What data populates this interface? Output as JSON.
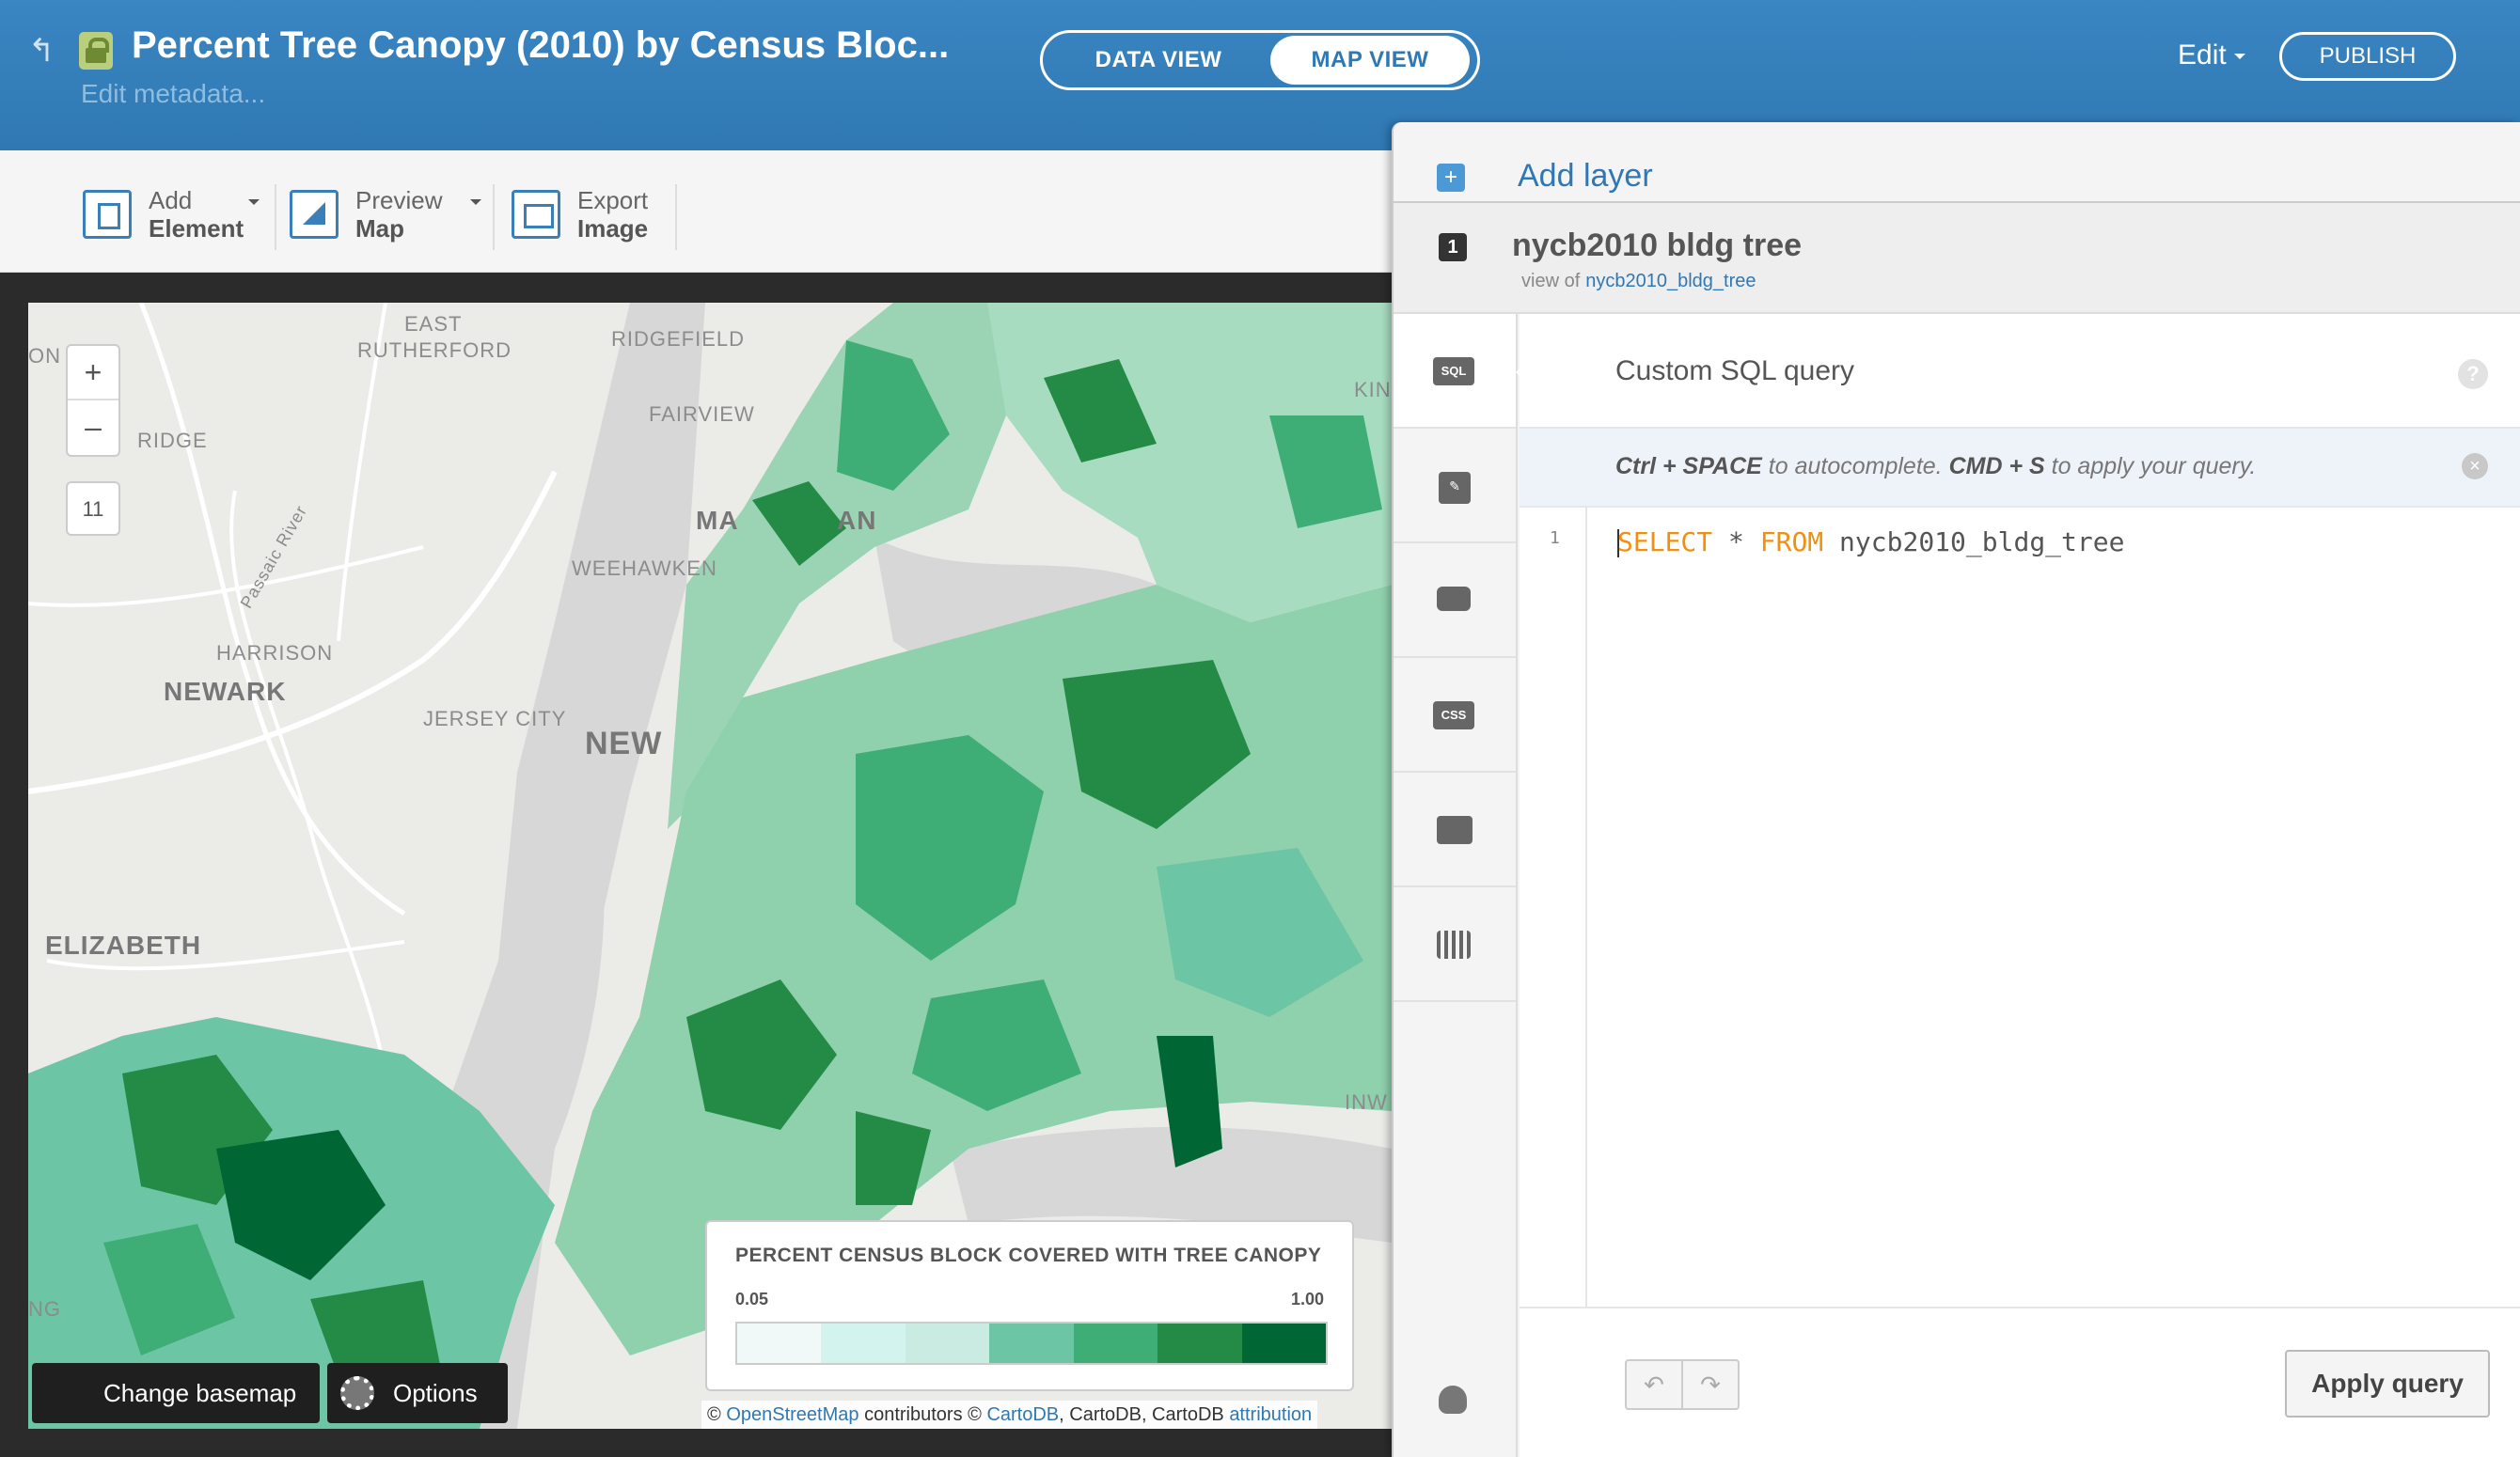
{
  "header": {
    "title": "Percent Tree Canopy (2010) by Census Bloc...",
    "subtitle": "Edit metadata...",
    "view_data": "DATA VIEW",
    "view_map": "MAP VIEW",
    "edit_label": "Edit",
    "publish_label": "PUBLISH"
  },
  "toolbar": {
    "add": {
      "line1": "Add",
      "line2": "Element"
    },
    "preview": {
      "line1": "Preview",
      "line2": "Map"
    },
    "export": {
      "line1": "Export",
      "line2": "Image"
    }
  },
  "map": {
    "zoom_in": "+",
    "zoom_out": "–",
    "zoom_level": "11",
    "labels": {
      "east_rutherford": "EAST",
      "east_rutherford2": "RUTHERFORD",
      "ridgefield": "RIDGEFIELD",
      "fairview": "FAIRVIEW",
      "ridge": "RIDGE",
      "passaic": "Passaic River",
      "weehawken": "WEEHAWKEN",
      "harrison": "HARRISON",
      "newark": "NEWARK",
      "jersey_city": "JERSEY CITY",
      "new_york": "NEW",
      "elizabeth": "ELIZABETH",
      "ma": "MA",
      "an": "AN",
      "kin": "KIN",
      "inw": "INW",
      "on": "ON",
      "ng": "NG"
    },
    "legend": {
      "title": "PERCENT CENSUS BLOCK COVERED WITH TREE CANOPY",
      "min": "0.05",
      "max": "1.00",
      "colors": [
        "#f0f9f8",
        "#d3f4ee",
        "#c9ebe1",
        "#6cc5a4",
        "#3fae76",
        "#238b45",
        "#006633"
      ]
    },
    "change_basemap": "Change basemap",
    "options": "Options",
    "attribution": {
      "prefix": "©",
      "osm": "OpenStreetMap",
      "mid": "contributors ©",
      "cartodb": "CartoDB",
      "mid2": ", CartoDB, CartoDB",
      "attr": "attribution"
    }
  },
  "panel": {
    "add_layer": "Add layer",
    "layer_number": "1",
    "layer_name": "nycb2010 bldg tree",
    "view_of": "view of",
    "source_table": "nycb2010_bldg_tree",
    "tabs": [
      "SQL",
      "wizard",
      "infowindow",
      "CSS",
      "legend",
      "filters"
    ],
    "editor_title": "Custom SQL query",
    "help": "?",
    "hint": {
      "k1": "Ctrl + SPACE",
      "t1": " to autocomplete. ",
      "k2": "CMD + S",
      "t2": " to apply your query."
    },
    "line_number": "1",
    "code": {
      "select": "SELECT",
      "star": " * ",
      "from": "FROM",
      "table": " nycb2010_bldg_tree"
    },
    "undo": "↶",
    "redo": "↷",
    "apply": "Apply query"
  }
}
